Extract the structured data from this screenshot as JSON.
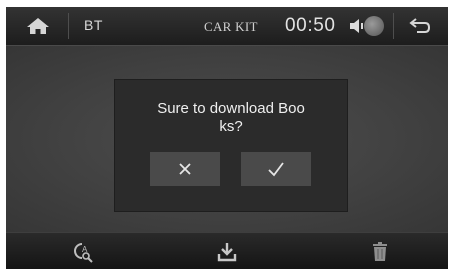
{
  "topbar": {
    "home_icon": "home-icon",
    "section_label": "BT",
    "title": "CAR KIT",
    "clock": "00:50",
    "speaker_icon": "speaker-icon",
    "status_icon": "bluetooth-status-icon",
    "back_icon": "back-arrow-icon"
  },
  "dialog": {
    "message_line1": "Sure to download Boo",
    "message_line2": "ks?",
    "cancel_icon": "close-icon",
    "confirm_icon": "checkmark-icon"
  },
  "bottombar": {
    "icons": [
      "search-contact-icon",
      "download-icon",
      "delete-icon"
    ]
  },
  "colors": {
    "background": "#404040",
    "bar": "#1d1d1d",
    "dialog": "#2b2b2b",
    "dialog_button": "#4a4a4a",
    "text": "#efefef"
  }
}
